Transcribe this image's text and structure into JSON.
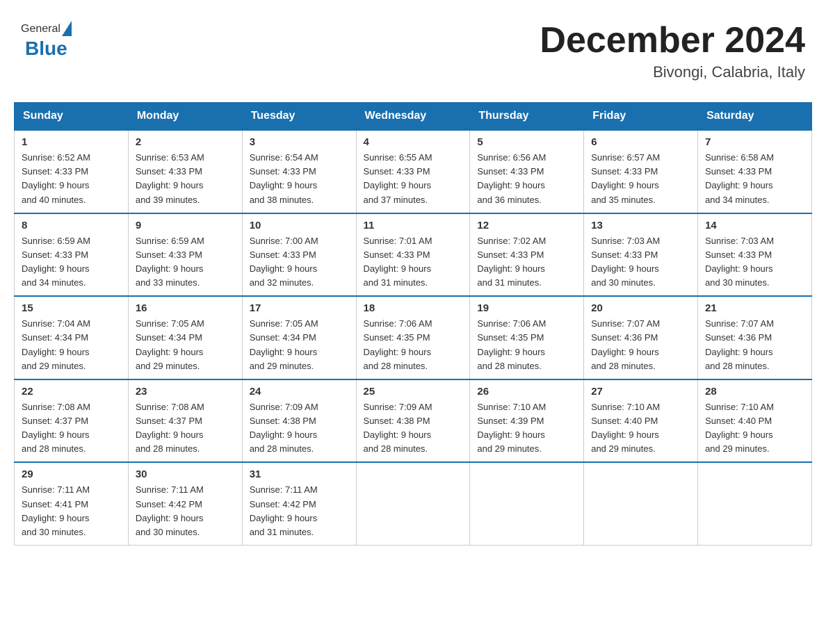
{
  "header": {
    "logo": {
      "text1": "General",
      "text2": "Blue"
    },
    "title": "December 2024",
    "location": "Bivongi, Calabria, Italy"
  },
  "days_of_week": [
    "Sunday",
    "Monday",
    "Tuesday",
    "Wednesday",
    "Thursday",
    "Friday",
    "Saturday"
  ],
  "weeks": [
    [
      {
        "day": "1",
        "sunrise": "6:52 AM",
        "sunset": "4:33 PM",
        "daylight": "9 hours and 40 minutes."
      },
      {
        "day": "2",
        "sunrise": "6:53 AM",
        "sunset": "4:33 PM",
        "daylight": "9 hours and 39 minutes."
      },
      {
        "day": "3",
        "sunrise": "6:54 AM",
        "sunset": "4:33 PM",
        "daylight": "9 hours and 38 minutes."
      },
      {
        "day": "4",
        "sunrise": "6:55 AM",
        "sunset": "4:33 PM",
        "daylight": "9 hours and 37 minutes."
      },
      {
        "day": "5",
        "sunrise": "6:56 AM",
        "sunset": "4:33 PM",
        "daylight": "9 hours and 36 minutes."
      },
      {
        "day": "6",
        "sunrise": "6:57 AM",
        "sunset": "4:33 PM",
        "daylight": "9 hours and 35 minutes."
      },
      {
        "day": "7",
        "sunrise": "6:58 AM",
        "sunset": "4:33 PM",
        "daylight": "9 hours and 34 minutes."
      }
    ],
    [
      {
        "day": "8",
        "sunrise": "6:59 AM",
        "sunset": "4:33 PM",
        "daylight": "9 hours and 34 minutes."
      },
      {
        "day": "9",
        "sunrise": "6:59 AM",
        "sunset": "4:33 PM",
        "daylight": "9 hours and 33 minutes."
      },
      {
        "day": "10",
        "sunrise": "7:00 AM",
        "sunset": "4:33 PM",
        "daylight": "9 hours and 32 minutes."
      },
      {
        "day": "11",
        "sunrise": "7:01 AM",
        "sunset": "4:33 PM",
        "daylight": "9 hours and 31 minutes."
      },
      {
        "day": "12",
        "sunrise": "7:02 AM",
        "sunset": "4:33 PM",
        "daylight": "9 hours and 31 minutes."
      },
      {
        "day": "13",
        "sunrise": "7:03 AM",
        "sunset": "4:33 PM",
        "daylight": "9 hours and 30 minutes."
      },
      {
        "day": "14",
        "sunrise": "7:03 AM",
        "sunset": "4:33 PM",
        "daylight": "9 hours and 30 minutes."
      }
    ],
    [
      {
        "day": "15",
        "sunrise": "7:04 AM",
        "sunset": "4:34 PM",
        "daylight": "9 hours and 29 minutes."
      },
      {
        "day": "16",
        "sunrise": "7:05 AM",
        "sunset": "4:34 PM",
        "daylight": "9 hours and 29 minutes."
      },
      {
        "day": "17",
        "sunrise": "7:05 AM",
        "sunset": "4:34 PM",
        "daylight": "9 hours and 29 minutes."
      },
      {
        "day": "18",
        "sunrise": "7:06 AM",
        "sunset": "4:35 PM",
        "daylight": "9 hours and 28 minutes."
      },
      {
        "day": "19",
        "sunrise": "7:06 AM",
        "sunset": "4:35 PM",
        "daylight": "9 hours and 28 minutes."
      },
      {
        "day": "20",
        "sunrise": "7:07 AM",
        "sunset": "4:36 PM",
        "daylight": "9 hours and 28 minutes."
      },
      {
        "day": "21",
        "sunrise": "7:07 AM",
        "sunset": "4:36 PM",
        "daylight": "9 hours and 28 minutes."
      }
    ],
    [
      {
        "day": "22",
        "sunrise": "7:08 AM",
        "sunset": "4:37 PM",
        "daylight": "9 hours and 28 minutes."
      },
      {
        "day": "23",
        "sunrise": "7:08 AM",
        "sunset": "4:37 PM",
        "daylight": "9 hours and 28 minutes."
      },
      {
        "day": "24",
        "sunrise": "7:09 AM",
        "sunset": "4:38 PM",
        "daylight": "9 hours and 28 minutes."
      },
      {
        "day": "25",
        "sunrise": "7:09 AM",
        "sunset": "4:38 PM",
        "daylight": "9 hours and 28 minutes."
      },
      {
        "day": "26",
        "sunrise": "7:10 AM",
        "sunset": "4:39 PM",
        "daylight": "9 hours and 29 minutes."
      },
      {
        "day": "27",
        "sunrise": "7:10 AM",
        "sunset": "4:40 PM",
        "daylight": "9 hours and 29 minutes."
      },
      {
        "day": "28",
        "sunrise": "7:10 AM",
        "sunset": "4:40 PM",
        "daylight": "9 hours and 29 minutes."
      }
    ],
    [
      {
        "day": "29",
        "sunrise": "7:11 AM",
        "sunset": "4:41 PM",
        "daylight": "9 hours and 30 minutes."
      },
      {
        "day": "30",
        "sunrise": "7:11 AM",
        "sunset": "4:42 PM",
        "daylight": "9 hours and 30 minutes."
      },
      {
        "day": "31",
        "sunrise": "7:11 AM",
        "sunset": "4:42 PM",
        "daylight": "9 hours and 31 minutes."
      },
      null,
      null,
      null,
      null
    ]
  ],
  "labels": {
    "sunrise": "Sunrise:",
    "sunset": "Sunset:",
    "daylight": "Daylight:"
  },
  "colors": {
    "header_bg": "#1a6faf",
    "header_text": "#ffffff",
    "border": "#1a6faf"
  }
}
